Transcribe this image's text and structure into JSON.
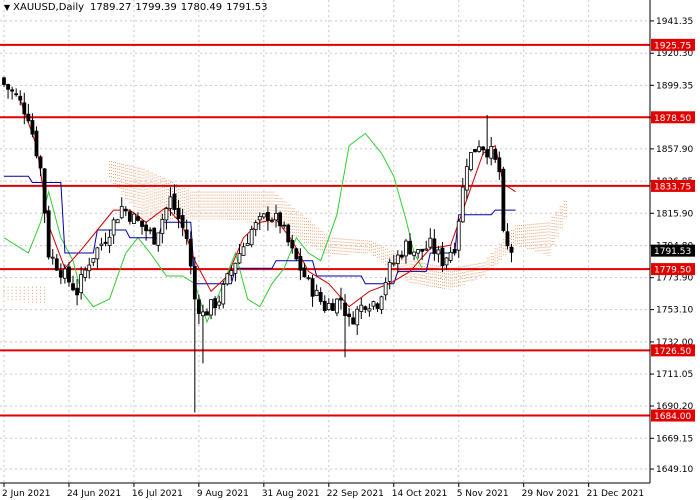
{
  "header": {
    "symbol": "XAUUSD,Daily",
    "ohlc": [
      "1789.27",
      "1799.39",
      "1780.49",
      "1791.53"
    ]
  },
  "colors": {
    "background": "#ffffff",
    "grid": "#c8c8c8",
    "candle": "#000000",
    "level_line": "#e00000",
    "tenkan": "#cc0000",
    "kijun": "#0000aa",
    "chikou": "#33cc33",
    "cloud_dots": "#e8a070"
  },
  "chart_data": {
    "type": "candlestick",
    "ylim": [
      1640,
      1955
    ],
    "yticks": [
      1941.35,
      1920.3,
      1899.35,
      1878.5,
      1857.9,
      1836.85,
      1815.9,
      1794.8,
      1773.9,
      1753.1,
      1732.0,
      1711.05,
      1690.2,
      1669.15,
      1649.1
    ],
    "xticks": [
      {
        "i": 0,
        "label": "2 Jun 2021"
      },
      {
        "i": 16,
        "label": "24 Jun 2021"
      },
      {
        "i": 32,
        "label": "16 Jul 2021"
      },
      {
        "i": 48,
        "label": "9 Aug 2021"
      },
      {
        "i": 64,
        "label": "31 Aug 2021"
      },
      {
        "i": 80,
        "label": "22 Sep 2021"
      },
      {
        "i": 96,
        "label": "14 Oct 2021"
      },
      {
        "i": 112,
        "label": "5 Nov 2021"
      },
      {
        "i": 128,
        "label": "29 Nov 2021"
      },
      {
        "i": 144,
        "label": "21 Dec 2021"
      }
    ],
    "levels": [
      {
        "value": 1925.75,
        "label": "1925.75"
      },
      {
        "value": 1878.5,
        "label": "1878.50"
      },
      {
        "value": 1833.75,
        "label": "1833.75"
      },
      {
        "value": 1779.5,
        "label": "1779.50"
      },
      {
        "value": 1726.5,
        "label": "1726.50"
      },
      {
        "value": 1684.0,
        "label": "1684.00"
      }
    ],
    "current_price": {
      "value": 1791.53,
      "label": "1791.53"
    },
    "candle_count": 126,
    "close_anchors": [
      [
        0,
        1900
      ],
      [
        3,
        1892
      ],
      [
        6,
        1880
      ],
      [
        9,
        1845
      ],
      [
        11,
        1790
      ],
      [
        15,
        1775
      ],
      [
        18,
        1765
      ],
      [
        21,
        1785
      ],
      [
        25,
        1800
      ],
      [
        29,
        1820
      ],
      [
        33,
        1810
      ],
      [
        37,
        1800
      ],
      [
        41,
        1825
      ],
      [
        45,
        1800
      ],
      [
        47,
        1760
      ],
      [
        49,
        1750
      ],
      [
        53,
        1760
      ],
      [
        57,
        1785
      ],
      [
        61,
        1805
      ],
      [
        65,
        1815
      ],
      [
        68,
        1810
      ],
      [
        71,
        1790
      ],
      [
        75,
        1770
      ],
      [
        79,
        1755
      ],
      [
        83,
        1760
      ],
      [
        85,
        1745
      ],
      [
        87,
        1752
      ],
      [
        89,
        1758
      ],
      [
        92,
        1758
      ],
      [
        95,
        1780
      ],
      [
        99,
        1795
      ],
      [
        102,
        1790
      ],
      [
        105,
        1795
      ],
      [
        108,
        1785
      ],
      [
        111,
        1795
      ],
      [
        114,
        1850
      ],
      [
        117,
        1862
      ],
      [
        120,
        1855
      ],
      [
        122,
        1843
      ],
      [
        123,
        1800
      ],
      [
        124,
        1793
      ],
      [
        125,
        1791.53
      ]
    ],
    "tenkan_anchors": [
      [
        4,
        1890
      ],
      [
        8,
        1860
      ],
      [
        11,
        1808
      ],
      [
        15,
        1780
      ],
      [
        19,
        1792
      ],
      [
        23,
        1805
      ],
      [
        27,
        1818
      ],
      [
        31,
        1818
      ],
      [
        35,
        1810
      ],
      [
        40,
        1820
      ],
      [
        44,
        1808
      ],
      [
        47,
        1785
      ],
      [
        51,
        1765
      ],
      [
        55,
        1775
      ],
      [
        59,
        1800
      ],
      [
        63,
        1810
      ],
      [
        67,
        1812
      ],
      [
        71,
        1798
      ],
      [
        75,
        1778
      ],
      [
        80,
        1770
      ],
      [
        85,
        1755
      ],
      [
        90,
        1765
      ],
      [
        95,
        1770
      ],
      [
        100,
        1778
      ],
      [
        105,
        1793
      ],
      [
        110,
        1795
      ],
      [
        114,
        1825
      ],
      [
        118,
        1855
      ],
      [
        121,
        1860
      ],
      [
        123,
        1835
      ],
      [
        126,
        1830
      ]
    ],
    "kijun_anchors": [
      [
        0,
        1840
      ],
      [
        6,
        1840
      ],
      [
        7,
        1836
      ],
      [
        14,
        1836
      ],
      [
        15,
        1790
      ],
      [
        22,
        1790
      ],
      [
        23,
        1805
      ],
      [
        30,
        1805
      ],
      [
        31,
        1800
      ],
      [
        38,
        1800
      ],
      [
        39,
        1810
      ],
      [
        46,
        1810
      ],
      [
        47,
        1770
      ],
      [
        56,
        1770
      ],
      [
        57,
        1780
      ],
      [
        66,
        1780
      ],
      [
        67,
        1785
      ],
      [
        76,
        1785
      ],
      [
        77,
        1775
      ],
      [
        88,
        1775
      ],
      [
        89,
        1770
      ],
      [
        96,
        1770
      ],
      [
        97,
        1778
      ],
      [
        104,
        1778
      ],
      [
        105,
        1790
      ],
      [
        111,
        1790
      ],
      [
        112,
        1815
      ],
      [
        120,
        1815
      ],
      [
        121,
        1818
      ],
      [
        126,
        1818
      ]
    ],
    "chikou_anchors": [
      [
        0,
        1800
      ],
      [
        3,
        1795
      ],
      [
        6,
        1790
      ],
      [
        9,
        1810
      ],
      [
        11,
        1830
      ],
      [
        14,
        1800
      ],
      [
        17,
        1785
      ],
      [
        19,
        1765
      ],
      [
        22,
        1755
      ],
      [
        26,
        1760
      ],
      [
        30,
        1790
      ],
      [
        33,
        1800
      ],
      [
        36,
        1790
      ],
      [
        40,
        1775
      ],
      [
        44,
        1775
      ],
      [
        47,
        1770
      ],
      [
        50,
        1745
      ],
      [
        54,
        1770
      ],
      [
        57,
        1790
      ],
      [
        60,
        1760
      ],
      [
        63,
        1755
      ],
      [
        66,
        1770
      ],
      [
        69,
        1780
      ],
      [
        72,
        1800
      ],
      [
        75,
        1790
      ],
      [
        78,
        1785
      ],
      [
        82,
        1815
      ],
      [
        85,
        1860
      ],
      [
        89,
        1868
      ],
      [
        93,
        1855
      ],
      [
        96,
        1840
      ],
      [
        99,
        1812
      ],
      [
        101,
        1790
      ],
      [
        103,
        1780
      ]
    ],
    "cloud_bands": [
      [
        26,
        1850,
        1838
      ],
      [
        34,
        1845,
        1812
      ],
      [
        46,
        1830,
        1812
      ],
      [
        54,
        1830,
        1812
      ],
      [
        66,
        1830,
        1808
      ],
      [
        80,
        1800,
        1788
      ],
      [
        90,
        1798,
        1790
      ],
      [
        100,
        1785,
        1770
      ],
      [
        110,
        1780,
        1766
      ],
      [
        118,
        1784,
        1775
      ],
      [
        126,
        1808,
        1795
      ],
      [
        134,
        1810,
        1788
      ],
      [
        138,
        1824,
        1812
      ]
    ]
  }
}
